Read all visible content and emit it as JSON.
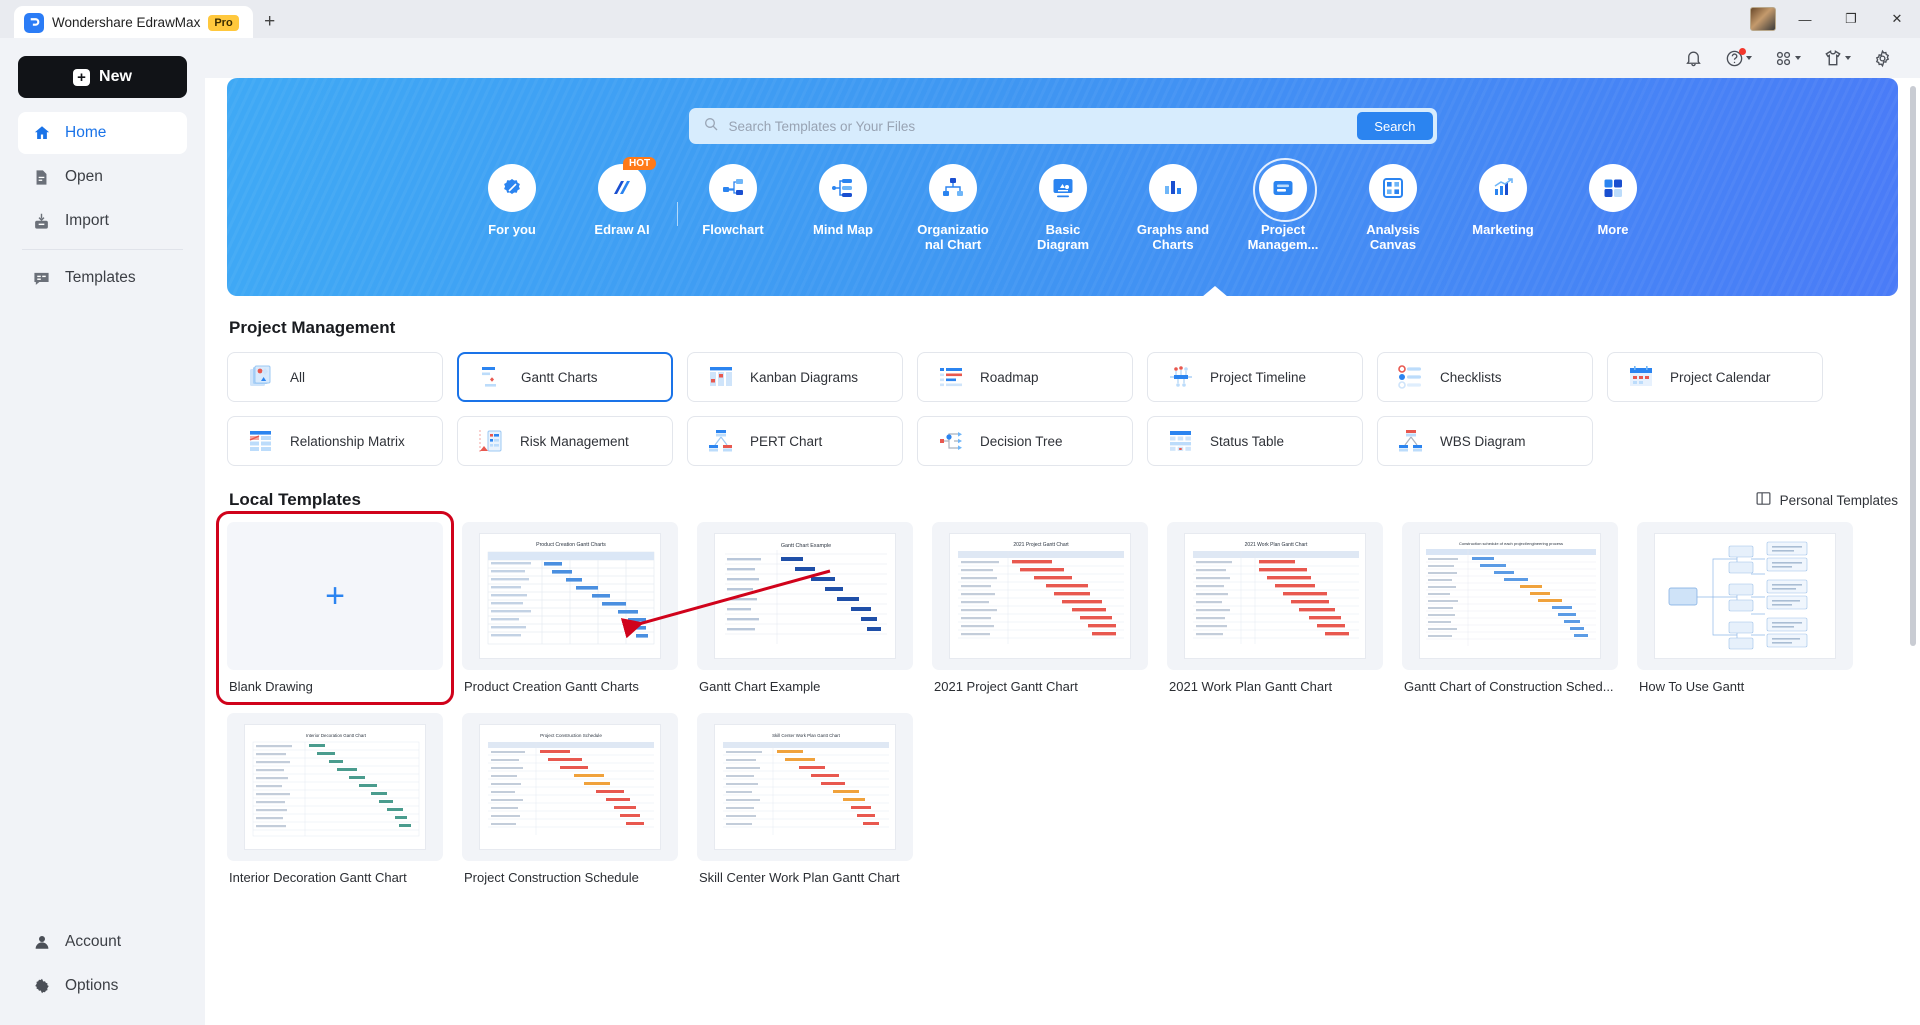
{
  "window": {
    "tab_title": "Wondershare EdrawMax",
    "pro_badge": "Pro",
    "new_tab": "+",
    "minimize": "—",
    "maximize": "❐",
    "close": "✕"
  },
  "sidebar": {
    "new_button": "New",
    "items": [
      {
        "label": "Home",
        "icon": "home-icon",
        "active": true
      },
      {
        "label": "Open",
        "icon": "folder-open-icon",
        "active": false
      },
      {
        "label": "Import",
        "icon": "import-icon",
        "active": false
      },
      {
        "label": "Templates",
        "icon": "templates-icon",
        "active": false
      }
    ],
    "bottom_items": [
      {
        "label": "Account",
        "icon": "account-icon"
      },
      {
        "label": "Options",
        "icon": "gear-icon"
      }
    ]
  },
  "topbar": {
    "icons": [
      {
        "name": "bell-icon",
        "has_caret": false,
        "has_dot": false
      },
      {
        "name": "help-icon",
        "has_caret": true,
        "has_dot": true
      },
      {
        "name": "apps-grid-icon",
        "has_caret": true,
        "has_dot": false
      },
      {
        "name": "theme-shirt-icon",
        "has_caret": true,
        "has_dot": false
      },
      {
        "name": "settings-gear-icon",
        "has_caret": false,
        "has_dot": false
      }
    ]
  },
  "search": {
    "placeholder": "Search Templates or Your Files",
    "value": "",
    "button_label": "Search"
  },
  "categories": [
    {
      "label": "For you",
      "icon": "for-you-icon",
      "badge": "",
      "selected": false
    },
    {
      "label": "Edraw AI",
      "icon": "edraw-ai-icon",
      "badge": "HOT",
      "selected": false
    },
    {
      "label": "Flowchart",
      "icon": "flowchart-icon",
      "badge": "",
      "selected": false
    },
    {
      "label": "Mind Map",
      "icon": "mind-map-icon",
      "badge": "",
      "selected": false
    },
    {
      "label": "Organizatio nal Chart",
      "icon": "org-chart-icon",
      "badge": "",
      "selected": false
    },
    {
      "label": "Basic Diagram",
      "icon": "basic-diagram-icon",
      "badge": "",
      "selected": false
    },
    {
      "label": "Graphs and Charts",
      "icon": "graphs-charts-icon",
      "badge": "",
      "selected": false
    },
    {
      "label": "Project Managem...",
      "icon": "project-management-icon",
      "badge": "",
      "selected": true
    },
    {
      "label": "Analysis Canvas",
      "icon": "analysis-canvas-icon",
      "badge": "",
      "selected": false
    },
    {
      "label": "Marketing",
      "icon": "marketing-icon",
      "badge": "",
      "selected": false
    },
    {
      "label": "More",
      "icon": "more-grid-icon",
      "badge": "",
      "selected": false
    }
  ],
  "project_management": {
    "title": "Project Management",
    "chips": [
      {
        "label": "All",
        "icon": "all-shapes-icon",
        "selected": false
      },
      {
        "label": "Gantt Charts",
        "icon": "gantt-chart-icon",
        "selected": true
      },
      {
        "label": "Kanban Diagrams",
        "icon": "kanban-icon",
        "selected": false
      },
      {
        "label": "Roadmap",
        "icon": "roadmap-icon",
        "selected": false
      },
      {
        "label": "Project Timeline",
        "icon": "timeline-icon",
        "selected": false
      },
      {
        "label": "Checklists",
        "icon": "checklist-icon",
        "selected": false
      },
      {
        "label": "Project Calendar",
        "icon": "calendar-icon",
        "selected": false
      },
      {
        "label": "Relationship Matrix",
        "icon": "matrix-icon",
        "selected": false
      },
      {
        "label": "Risk Management",
        "icon": "risk-icon",
        "selected": false
      },
      {
        "label": "PERT Chart",
        "icon": "pert-icon",
        "selected": false
      },
      {
        "label": "Decision Tree",
        "icon": "decision-tree-icon",
        "selected": false
      },
      {
        "label": "Status Table",
        "icon": "status-table-icon",
        "selected": false
      },
      {
        "label": "WBS Diagram",
        "icon": "wbs-icon",
        "selected": false
      }
    ]
  },
  "local_templates": {
    "title": "Local Templates",
    "personal_templates_label": "Personal Templates",
    "cards": [
      {
        "label": "Blank Drawing",
        "type": "blank",
        "highlight": true,
        "thumb_title": ""
      },
      {
        "label": "Product Creation Gantt  Charts",
        "type": "gantt",
        "highlight": false,
        "thumb_title": "Product Creation Gantt  Charts"
      },
      {
        "label": "Gantt Chart Example",
        "type": "gantt",
        "highlight": false,
        "thumb_title": "Gantt Chart Example"
      },
      {
        "label": "2021 Project Gantt Chart",
        "type": "gantt-red",
        "highlight": false,
        "thumb_title": "2021 Project Gantt Chart"
      },
      {
        "label": "2021 Work Plan Gantt Chart",
        "type": "gantt-red",
        "highlight": false,
        "thumb_title": "2021 Work Plan Gantt Chart"
      },
      {
        "label": "Gantt Chart of Construction Sched...",
        "type": "gantt",
        "highlight": false,
        "thumb_title": "Construction schedule of each project/engineering process"
      },
      {
        "label": "How To Use Gantt",
        "type": "mindmap",
        "highlight": false,
        "thumb_title": ""
      },
      {
        "label": "Interior Decoration Gantt Chart",
        "type": "gantt",
        "highlight": false,
        "thumb_title": "Interior Decoration Gantt Chart"
      },
      {
        "label": "Project Construction Schedule",
        "type": "gantt-red",
        "highlight": false,
        "thumb_title": "Project Construction Schedule"
      },
      {
        "label": "Skill Center Work Plan Gantt Chart",
        "type": "gantt-red",
        "highlight": false,
        "thumb_title": "Skill Center Work Plan Gantt Chart"
      }
    ]
  },
  "colors": {
    "accent": "#1a73e8",
    "banner_start": "#3fa9f5",
    "banner_end": "#4a7bf7",
    "highlight_red": "#d0021b",
    "hot_orange": "#ff7a18",
    "pro_yellow": "#ffc83d"
  }
}
